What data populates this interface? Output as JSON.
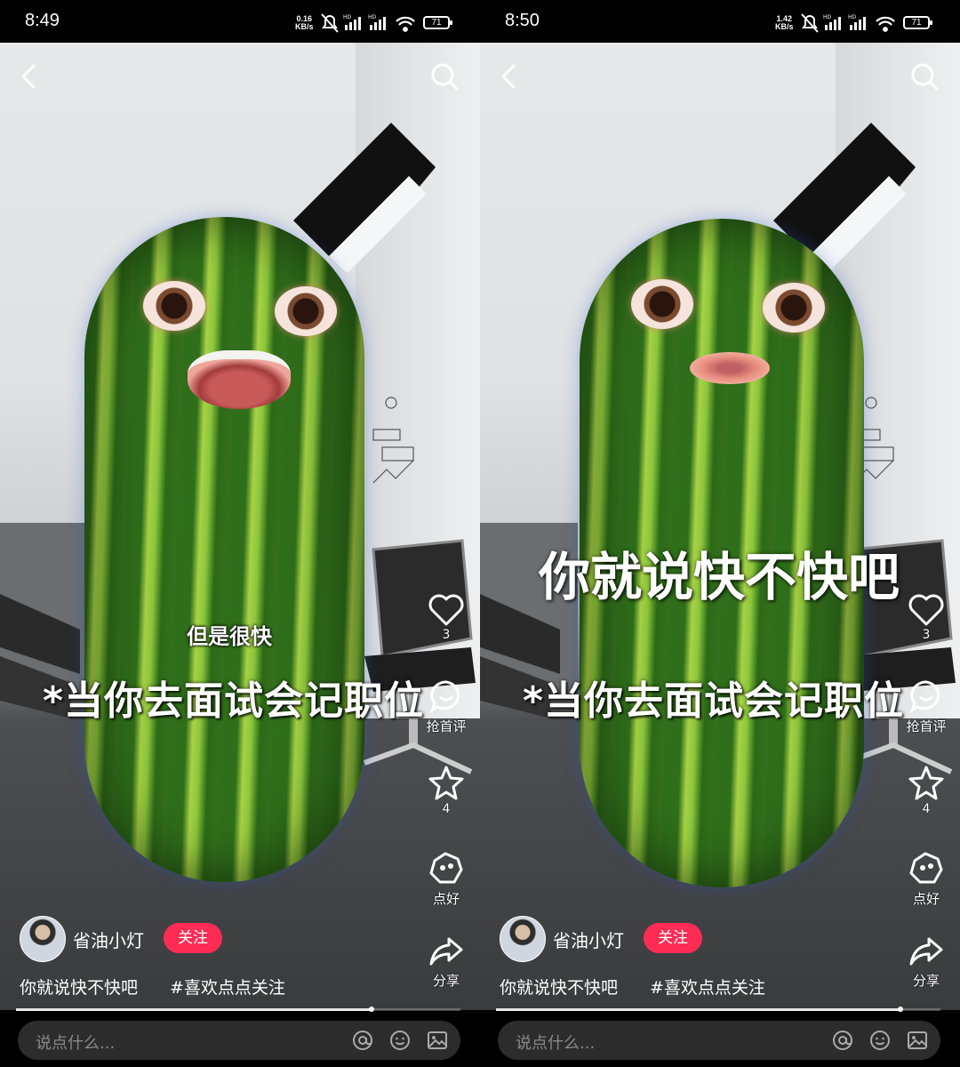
{
  "panels": [
    {
      "status": {
        "time": "8:49",
        "net_speed": "0.16",
        "net_unit": "KB/s",
        "battery": "71"
      },
      "subtitle": "但是很快",
      "overlay_text": "",
      "caption": "*当你去面试会记职位",
      "sidebar": {
        "like_count": "3",
        "comment_label": "抢首评",
        "favorite_count": "4",
        "tip_label": "点好",
        "share_label": "分享"
      },
      "author": {
        "name": "省油小灯",
        "follow_label": "关注"
      },
      "description": {
        "text": "你就说快不快吧",
        "hashtag": "#喜欢点点关注"
      },
      "progress": 0.8,
      "comment_placeholder": "说点什么..."
    },
    {
      "status": {
        "time": "8:50",
        "net_speed": "1.42",
        "net_unit": "KB/s",
        "battery": "71"
      },
      "subtitle": "",
      "overlay_text": "你就说快不快吧",
      "caption": "*当你去面试会记职位",
      "sidebar": {
        "like_count": "3",
        "comment_label": "抢首评",
        "favorite_count": "4",
        "tip_label": "点好",
        "share_label": "分享"
      },
      "author": {
        "name": "省油小灯",
        "follow_label": "关注"
      },
      "description": {
        "text": "你就说快不快吧",
        "hashtag": "#喜欢点点关注"
      },
      "progress": 0.91,
      "comment_placeholder": "说点什么..."
    }
  ],
  "colors": {
    "follow_button": "#fe2c55",
    "background": "#000000"
  }
}
